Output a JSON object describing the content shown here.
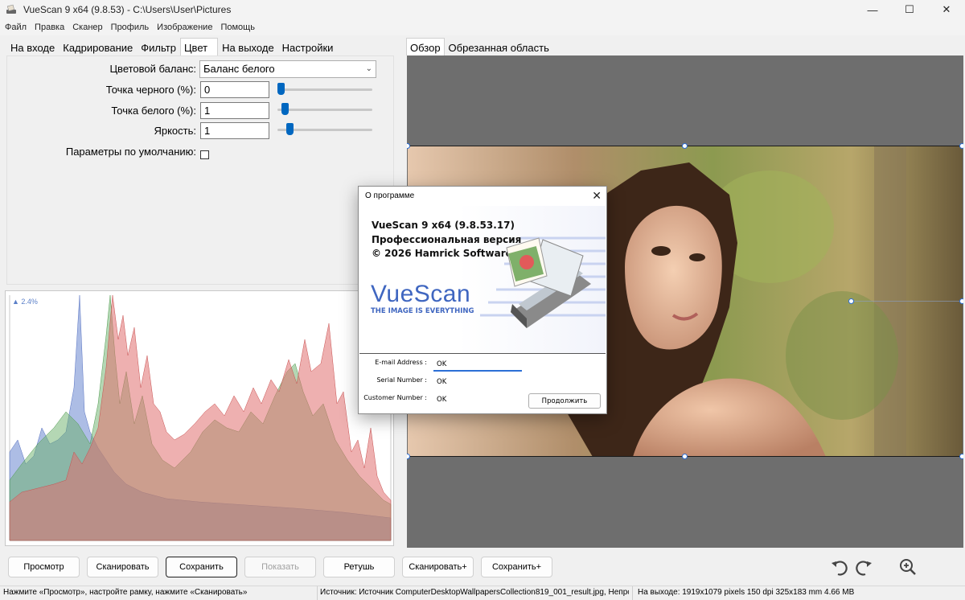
{
  "window": {
    "title": "VueScan 9 x64 (9.8.53) - C:\\Users\\User\\Pictures",
    "minimize_glyph": "—",
    "maximize_glyph": "☐",
    "close_glyph": "✕"
  },
  "menu": [
    "Файл",
    "Правка",
    "Сканер",
    "Профиль",
    "Изображение",
    "Помощь"
  ],
  "left_tabs": [
    "На входе",
    "Кадрирование",
    "Фильтр",
    "Цвет",
    "На выходе",
    "Настройки"
  ],
  "left_tabs_active": "Цвет",
  "color_panel": {
    "color_balance_label": "Цветовой баланс:",
    "color_balance_value": "Баланс белого",
    "black_point_label": "Точка черного (%):",
    "black_point_value": "0",
    "black_point_level": 0.0,
    "white_point_label": "Точка белого (%):",
    "white_point_value": "1",
    "brightness_label": "Яркость:",
    "brightness_value": "1",
    "defaults_label": "Параметры по умолчанию:"
  },
  "histogram": {
    "scale_label": "▲ 2.4%"
  },
  "right_tabs": [
    "Обзор",
    "Обрезанная область"
  ],
  "right_tabs_active": "Обзор",
  "dialog": {
    "title": "О программе",
    "close_glyph": "✕",
    "line1": "VueScan 9 x64 (9.8.53.17)",
    "line2": "Профессиональная версия",
    "line3": "© 2026 Hamrick Software",
    "logo_text": "VueScan",
    "logo_tagline": "THE IMAGE IS EVERYTHING",
    "email_label": "E-mail Address :",
    "email_value": "OK",
    "serial_label": "Serial Number :",
    "serial_value": "OK",
    "customer_label": "Customer Number :",
    "customer_value": "OK",
    "continue_label": "Продолжить"
  },
  "buttons": {
    "preview": "Просмотр",
    "scan": "Сканировать",
    "save": "Сохранить",
    "show": "Показать",
    "retouch": "Ретушь",
    "scan_plus": "Сканировать+",
    "save_plus": "Сохранить+"
  },
  "icons": {
    "rotate_left": "rotate-left-icon",
    "rotate_right": "rotate-right-icon",
    "zoom": "zoom-in-icon"
  },
  "status": {
    "left": "Нажмите «Просмотр», настройте рамку, нажмите «Сканировать»",
    "middle": "Источник: Источник ComputerDesktopWallpapersCollection819_001_result.jpg, Непроз...",
    "right": "На выходе: 1919x1079 pixels 150 dpi 325x183 mm 4.66 MB"
  },
  "colors": {
    "accent": "#0067c0",
    "handle": "#2c6fd6",
    "preview_bg": "#6e6e6e",
    "hist_red": "#e07070",
    "hist_green": "#6ab06a",
    "hist_blue": "#6a86d0"
  }
}
